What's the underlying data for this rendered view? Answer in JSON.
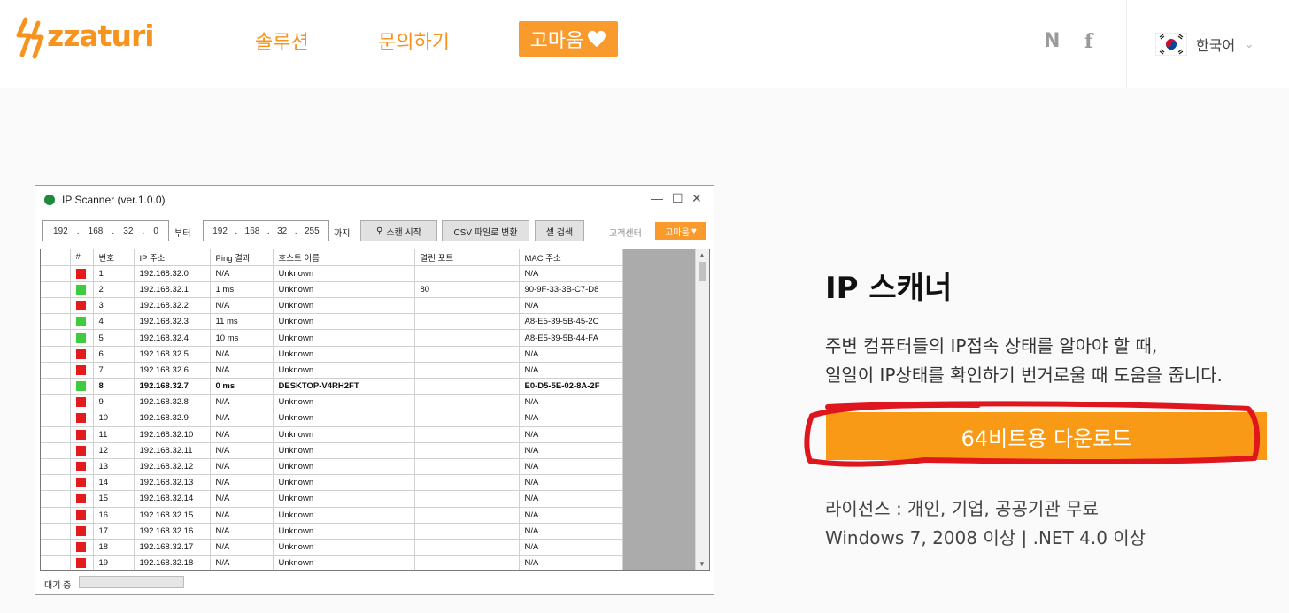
{
  "header": {
    "logo_text": "zzaturi",
    "nav": {
      "solution": "솔루션",
      "contact": "문의하기",
      "thanks": "고마움"
    },
    "sns": {
      "naver": "N",
      "facebook": "f"
    },
    "language": "한국어",
    "brand_color": "#f7941d"
  },
  "app": {
    "title": "IP Scanner (ver.1.0.0)",
    "from_ip": [
      "192",
      "168",
      "32",
      "0"
    ],
    "to_ip": [
      "192",
      "168",
      "32",
      "255"
    ],
    "sep": ".",
    "from_label": "부터",
    "to_label": "까지",
    "scan_button": "스캔 시작",
    "csv_button": "CSV 파일로 변환",
    "cell_search_button": "셀 검색",
    "support_link": "고객센터",
    "thanks_button": "고마움",
    "columns": [
      "#",
      "번호",
      "IP 주소",
      "Ping 결과",
      "호스트 이름",
      "열린 포트",
      "MAC 주소"
    ],
    "rows": [
      {
        "status": "red",
        "no": "1",
        "ip": "192.168.32.0",
        "ping": "N/A",
        "host": "Unknown",
        "port": "",
        "mac": "N/A"
      },
      {
        "status": "green",
        "no": "2",
        "ip": "192.168.32.1",
        "ping": "1 ms",
        "host": "Unknown",
        "port": "80",
        "mac": "90-9F-33-3B-C7-D8"
      },
      {
        "status": "red",
        "no": "3",
        "ip": "192.168.32.2",
        "ping": "N/A",
        "host": "Unknown",
        "port": "",
        "mac": "N/A"
      },
      {
        "status": "green",
        "no": "4",
        "ip": "192.168.32.3",
        "ping": "11 ms",
        "host": "Unknown",
        "port": "",
        "mac": "A8-E5-39-5B-45-2C"
      },
      {
        "status": "green",
        "no": "5",
        "ip": "192.168.32.4",
        "ping": "10 ms",
        "host": "Unknown",
        "port": "",
        "mac": "A8-E5-39-5B-44-FA"
      },
      {
        "status": "red",
        "no": "6",
        "ip": "192.168.32.5",
        "ping": "N/A",
        "host": "Unknown",
        "port": "",
        "mac": "N/A"
      },
      {
        "status": "red",
        "no": "7",
        "ip": "192.168.32.6",
        "ping": "N/A",
        "host": "Unknown",
        "port": "",
        "mac": "N/A"
      },
      {
        "status": "green",
        "no": "8",
        "ip": "192.168.32.7",
        "ping": "0 ms",
        "host": "DESKTOP-V4RH2FT",
        "port": "",
        "mac": "E0-D5-5E-02-8A-2F",
        "bold": true
      },
      {
        "status": "red",
        "no": "9",
        "ip": "192.168.32.8",
        "ping": "N/A",
        "host": "Unknown",
        "port": "",
        "mac": "N/A"
      },
      {
        "status": "red",
        "no": "10",
        "ip": "192.168.32.9",
        "ping": "N/A",
        "host": "Unknown",
        "port": "",
        "mac": "N/A"
      },
      {
        "status": "red",
        "no": "11",
        "ip": "192.168.32.10",
        "ping": "N/A",
        "host": "Unknown",
        "port": "",
        "mac": "N/A"
      },
      {
        "status": "red",
        "no": "12",
        "ip": "192.168.32.11",
        "ping": "N/A",
        "host": "Unknown",
        "port": "",
        "mac": "N/A"
      },
      {
        "status": "red",
        "no": "13",
        "ip": "192.168.32.12",
        "ping": "N/A",
        "host": "Unknown",
        "port": "",
        "mac": "N/A"
      },
      {
        "status": "red",
        "no": "14",
        "ip": "192.168.32.13",
        "ping": "N/A",
        "host": "Unknown",
        "port": "",
        "mac": "N/A"
      },
      {
        "status": "red",
        "no": "15",
        "ip": "192.168.32.14",
        "ping": "N/A",
        "host": "Unknown",
        "port": "",
        "mac": "N/A"
      },
      {
        "status": "red",
        "no": "16",
        "ip": "192.168.32.15",
        "ping": "N/A",
        "host": "Unknown",
        "port": "",
        "mac": "N/A"
      },
      {
        "status": "red",
        "no": "17",
        "ip": "192.168.32.16",
        "ping": "N/A",
        "host": "Unknown",
        "port": "",
        "mac": "N/A"
      },
      {
        "status": "red",
        "no": "18",
        "ip": "192.168.32.17",
        "ping": "N/A",
        "host": "Unknown",
        "port": "",
        "mac": "N/A"
      },
      {
        "status": "red",
        "no": "19",
        "ip": "192.168.32.18",
        "ping": "N/A",
        "host": "Unknown",
        "port": "",
        "mac": "N/A"
      }
    ],
    "status_text": "대기 중",
    "status_colors": {
      "red": "#e31b1b",
      "green": "#3ecb3e"
    }
  },
  "product": {
    "title": "IP 스캐너",
    "desc_line1": "주변 컴퓨터들의 IP접속 상태를 알아야 할 때,",
    "desc_line2": "일일이 IP상태를 확인하기 번거로울 때 도움을 줍니다.",
    "download_button": "64비트용 다운로드",
    "license": "라이선스 : 개인, 기업, 공공기관 무료",
    "requirements": "Windows 7, 2008 이상 | .NET 4.0 이상",
    "accent_color": "#f99a17"
  }
}
